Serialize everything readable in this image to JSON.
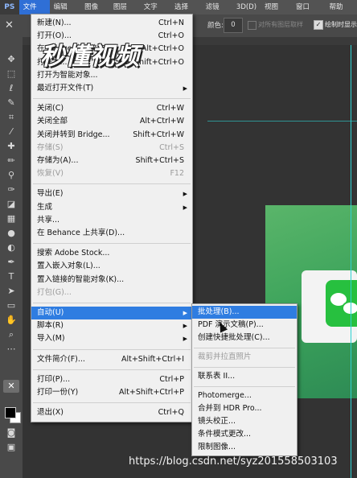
{
  "app_logo": "PS",
  "menubar": [
    {
      "label": "文件(F)",
      "active": true
    },
    {
      "label": "编辑(E)"
    },
    {
      "label": "图像(I)"
    },
    {
      "label": "图层(L)"
    },
    {
      "label": "文字(Y)"
    },
    {
      "label": "选择(S)"
    },
    {
      "label": "滤镜(T)"
    },
    {
      "label": "3D(D)"
    },
    {
      "label": "视图(V)"
    },
    {
      "label": "窗口(W)"
    },
    {
      "label": "帮助(H)"
    }
  ],
  "options_bar": {
    "mode_label": "颜色:",
    "mode_value": "0",
    "option1_label": "对所有图层取样",
    "option2_label": "绘制时显示"
  },
  "file_menu": {
    "items": [
      {
        "label": "新建(N)...",
        "shortcut": "Ctrl+N"
      },
      {
        "label": "打开(O)...",
        "shortcut": "Ctrl+O"
      },
      {
        "label": "在 Bridge 中浏览(B)...",
        "shortcut": "Alt+Ctrl+O"
      },
      {
        "label": "打开为...",
        "shortcut": "Alt+Shift+Ctrl+O"
      },
      {
        "label": "打开为智能对象..."
      },
      {
        "label": "最近打开文件(T)",
        "submenu": true
      },
      {
        "sep": true
      },
      {
        "label": "关闭(C)",
        "shortcut": "Ctrl+W"
      },
      {
        "label": "关闭全部",
        "shortcut": "Alt+Ctrl+W"
      },
      {
        "label": "关闭并转到 Bridge...",
        "shortcut": "Shift+Ctrl+W"
      },
      {
        "label": "存储(S)",
        "shortcut": "Ctrl+S",
        "disabled": true
      },
      {
        "label": "存储为(A)...",
        "shortcut": "Shift+Ctrl+S"
      },
      {
        "label": "恢复(V)",
        "shortcut": "F12",
        "disabled": true
      },
      {
        "sep": true
      },
      {
        "label": "导出(E)",
        "submenu": true
      },
      {
        "label": "生成",
        "submenu": true
      },
      {
        "label": "共享..."
      },
      {
        "label": "在 Behance 上共享(D)..."
      },
      {
        "sep": true
      },
      {
        "label": "搜索 Adobe Stock..."
      },
      {
        "label": "置入嵌入对象(L)..."
      },
      {
        "label": "置入链接的智能对象(K)..."
      },
      {
        "label": "打包(G)...",
        "disabled": true
      },
      {
        "sep": true
      },
      {
        "label": "自动(U)",
        "submenu": true,
        "highlighted": true
      },
      {
        "label": "脚本(R)",
        "submenu": true
      },
      {
        "label": "导入(M)",
        "submenu": true
      },
      {
        "sep": true
      },
      {
        "label": "文件简介(F)...",
        "shortcut": "Alt+Shift+Ctrl+I"
      },
      {
        "sep": true
      },
      {
        "label": "打印(P)...",
        "shortcut": "Ctrl+P"
      },
      {
        "label": "打印一份(Y)",
        "shortcut": "Alt+Shift+Ctrl+P"
      },
      {
        "sep": true
      },
      {
        "label": "退出(X)",
        "shortcut": "Ctrl+Q"
      }
    ]
  },
  "automate_submenu": {
    "items": [
      {
        "label": "批处理(B)...",
        "highlighted": true
      },
      {
        "label": "PDF 演示文稿(P)..."
      },
      {
        "label": "创建快捷批处理(C)..."
      },
      {
        "sep": true
      },
      {
        "label": "裁剪并拉直照片",
        "disabled": true
      },
      {
        "sep": true
      },
      {
        "label": "联系表 II..."
      },
      {
        "sep": true
      },
      {
        "label": "Photomerge..."
      },
      {
        "label": "合并到 HDR Pro..."
      },
      {
        "label": "镜头校正..."
      },
      {
        "label": "条件模式更改..."
      },
      {
        "label": "限制图像..."
      }
    ]
  },
  "watermark_logo": "秒懂视频",
  "watermark_url": "https://blog.csdn.net/syz201558503103",
  "colors": {
    "menu_highlight": "#2f7de1",
    "foreground": "#000000",
    "background": "#ffffff"
  }
}
